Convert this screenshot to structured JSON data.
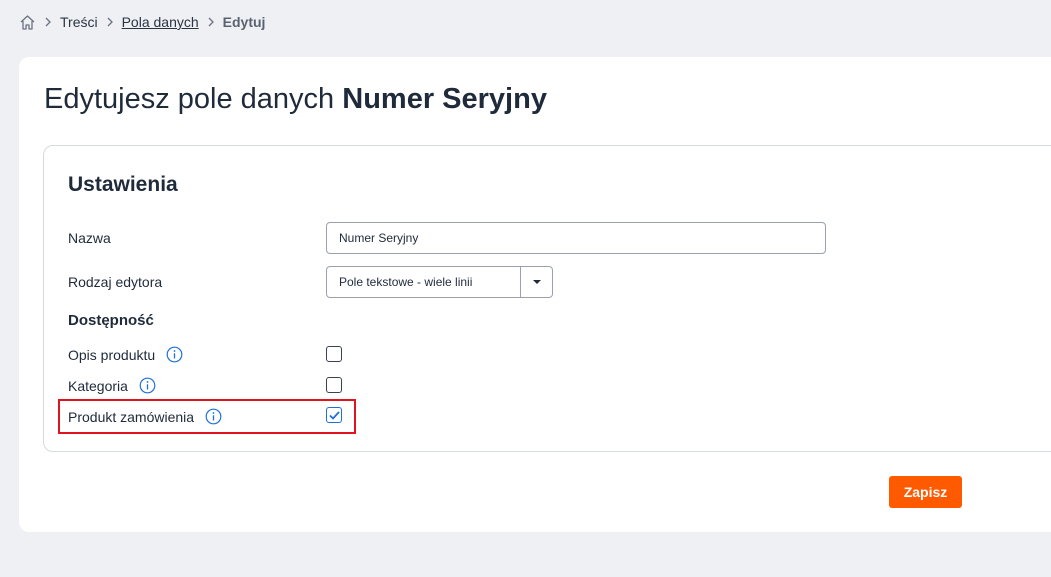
{
  "breadcrumb": {
    "items": [
      "Treści",
      "Pola danych",
      "Edytuj"
    ]
  },
  "page": {
    "title_prefix": "Edytujesz pole danych ",
    "title_name": "Numer Seryjny"
  },
  "settings": {
    "title": "Ustawienia",
    "name_label": "Nazwa",
    "name_value": "Numer Seryjny",
    "editor_label": "Rodzaj edytora",
    "editor_value": "Pole tekstowe - wiele linii",
    "availability_heading": "Dostępność",
    "availability": [
      {
        "label": "Opis produktu",
        "checked": false
      },
      {
        "label": "Kategoria",
        "checked": false
      },
      {
        "label": "Produkt zamówienia",
        "checked": true
      }
    ]
  },
  "actions": {
    "save_label": "Zapisz"
  },
  "colors": {
    "accent": "#ff5a00",
    "info": "#1e6fd9",
    "highlight": "#e0141f"
  }
}
